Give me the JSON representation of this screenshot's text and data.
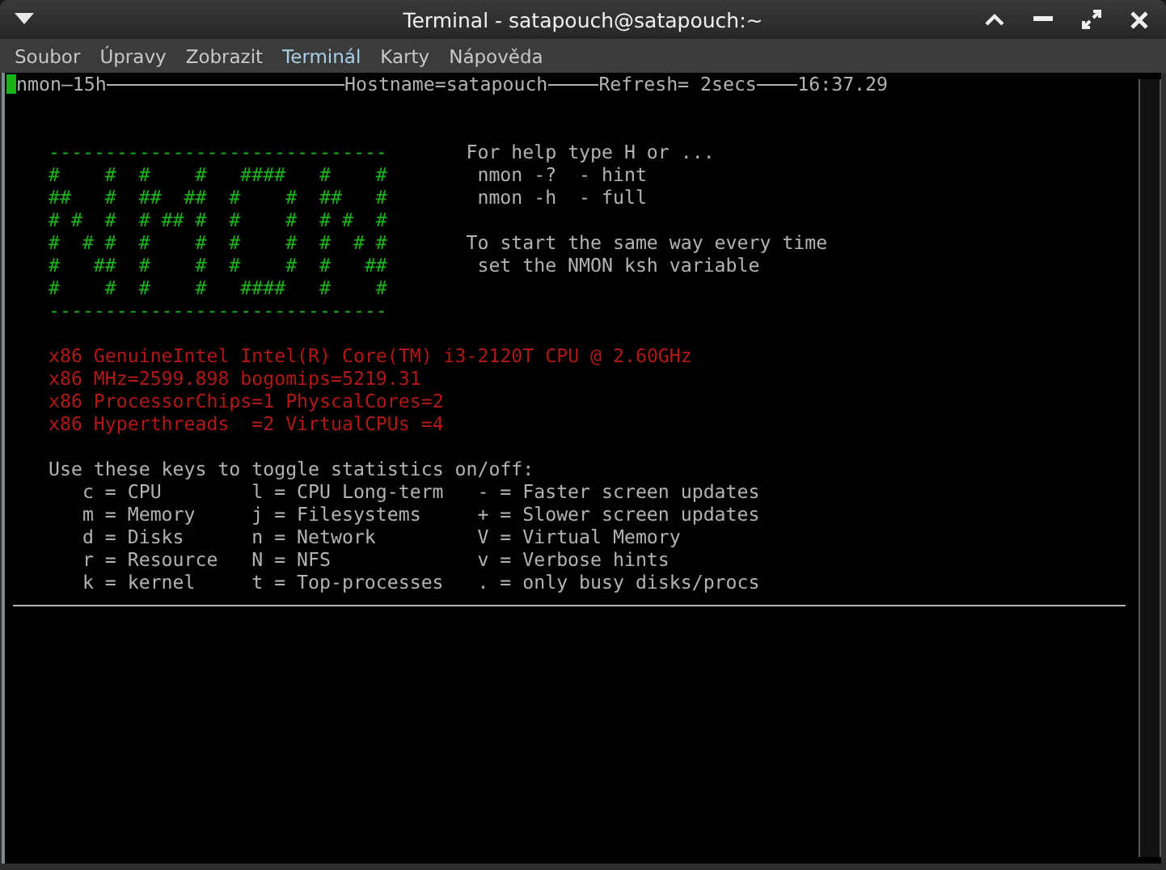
{
  "window": {
    "title": "Terminal - satapouch@satapouch:~"
  },
  "menu": [
    {
      "label": "Soubor",
      "hovered": false
    },
    {
      "label": "Úpravy",
      "hovered": false
    },
    {
      "label": "Zobrazit",
      "hovered": false
    },
    {
      "label": "Terminál",
      "hovered": true
    },
    {
      "label": "Karty",
      "hovered": false
    },
    {
      "label": "Nápověda",
      "hovered": false
    }
  ],
  "terminal": {
    "header": {
      "program": "nmon—15h",
      "hostname": "Hostname=satapouch",
      "refresh": "Refresh= 2secs",
      "time": "16:37.29"
    },
    "logo_lines": [
      "------------------------------",
      "#    #  #    #   ####   #    #",
      "##   #  ##  ##  #    #  ##   #",
      "# #  #  # ## #  #    #  # #  #",
      "#  # #  #    #  #    #  #  # #",
      "#   ##  #    #  #    #  #   ##",
      "#    #  #    #   ####   #    #",
      "------------------------------"
    ],
    "help": [
      {
        "title": "For help type H or ...",
        "lines": [
          "nmon -?  - hint",
          "nmon -h  - full"
        ]
      },
      {
        "title": "To start the same way every time",
        "lines": [
          "set the NMON ksh variable"
        ]
      }
    ],
    "cpu_info": [
      "x86 GenuineIntel Intel(R) Core(TM) i3-2120T CPU @ 2.60GHz",
      "x86 MHz=2599.898 bogomips=5219.31",
      "x86 ProcessorChips=1 PhyscalCores=2",
      "x86 Hyperthreads  =2 VirtualCPUs =4"
    ],
    "keys": {
      "heading": "Use these keys to toggle statistics on/off:",
      "rows": [
        [
          "c = CPU",
          "l = CPU Long-term",
          "- = Faster screen updates"
        ],
        [
          "m = Memory",
          "j = Filesystems",
          "+ = Slower screen updates"
        ],
        [
          "d = Disks",
          "n = Network",
          "V = Virtual Memory"
        ],
        [
          "r = Resource",
          "N = NFS",
          "v = Verbose hints"
        ],
        [
          "k = kernel",
          "t = Top-processes",
          ". = only busy disks/procs"
        ]
      ]
    }
  }
}
